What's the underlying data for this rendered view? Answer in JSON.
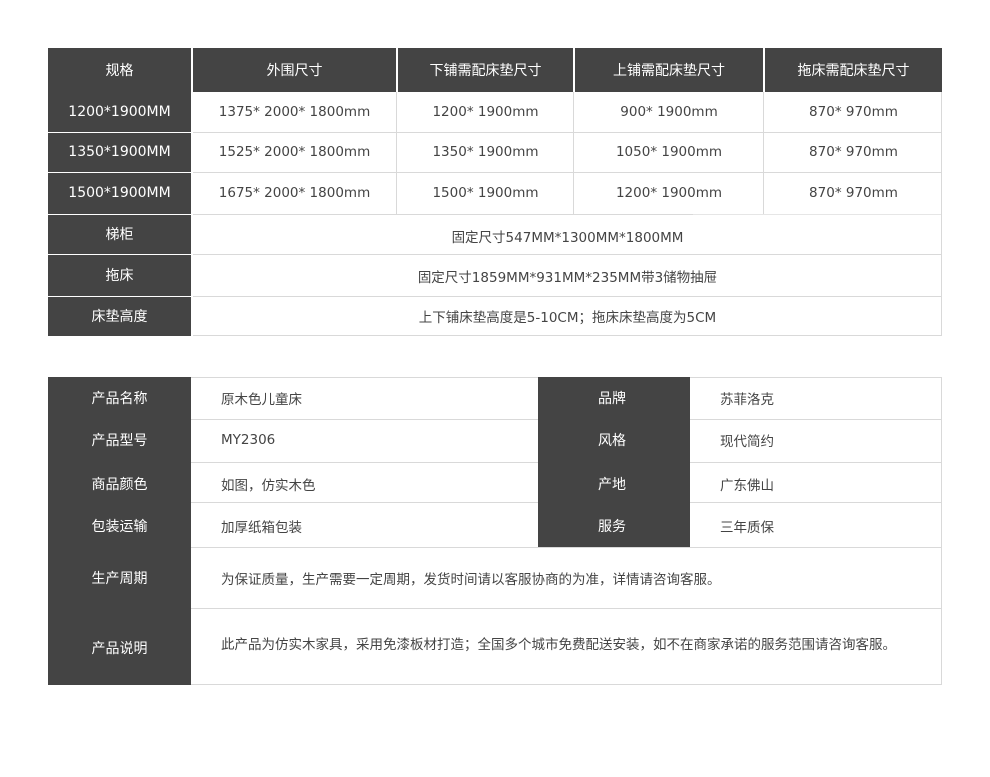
{
  "spec_table": {
    "headers": [
      "规格",
      "外围尺寸",
      "下铺需配床垫尺寸",
      "上铺需配床垫尺寸",
      "拖床需配床垫尺寸"
    ],
    "rows": [
      [
        "1200*1900MM",
        "1375* 2000* 1800mm",
        "1200* 1900mm",
        "900* 1900mm",
        "870* 970mm"
      ],
      [
        "1350*1900MM",
        "1525* 2000* 1800mm",
        "1350* 1900mm",
        "1050* 1900mm",
        "870* 970mm"
      ],
      [
        "1500*1900MM",
        "1675* 2000* 1800mm",
        "1500* 1900mm",
        "1200* 1900mm",
        "870* 970mm"
      ]
    ],
    "merged_rows": [
      {
        "label": "梯柜",
        "value": "固定尺寸547MM*1300MM*1800MM"
      },
      {
        "label": "拖床",
        "value": "固定尺寸1859MM*931MM*235MM带3储物抽屉"
      },
      {
        "label": "床垫高度",
        "value": "上下铺床垫高度是5-10CM；拖床床垫高度为5CM"
      }
    ]
  },
  "info_table": {
    "pairs": [
      {
        "label": "产品名称",
        "value": "原木色儿童床",
        "label2": "品牌",
        "value2": "苏菲洛克"
      },
      {
        "label": "产品型号",
        "value": "MY2306",
        "label2": "风格",
        "value2": "现代简约"
      },
      {
        "label": "商品颜色",
        "value": "如图，仿实木色",
        "label2": "产地",
        "value2": "广东佛山"
      },
      {
        "label": "包装运输",
        "value": "加厚纸箱包装",
        "label2": "服务",
        "value2": "三年质保"
      }
    ],
    "wide_rows": [
      {
        "label": "生产周期",
        "value": "为保证质量，生产需要一定周期，发货时间请以客服协商的为准，详情请咨询客服。"
      },
      {
        "label": "产品说明",
        "value": "此产品为仿实木家具，采用免漆板材打造；全国多个城市免费配送安装，如不在商家承诺的服务范围请咨询客服。"
      }
    ]
  }
}
